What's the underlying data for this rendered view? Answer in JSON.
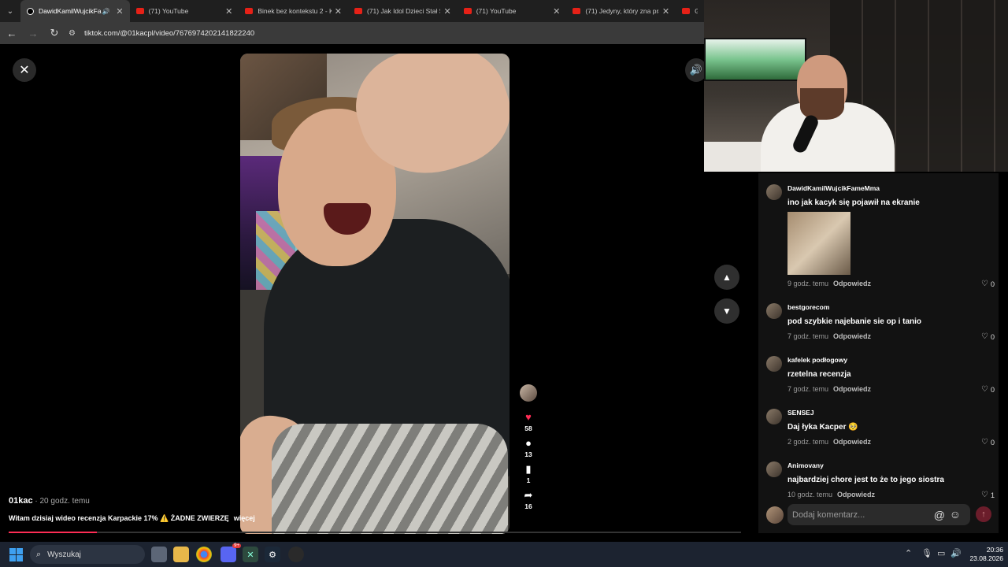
{
  "tabs": [
    {
      "title": "DawidKamilWujcikFameMma",
      "active": true,
      "icon": "tiktok-icon",
      "audio": true
    },
    {
      "title": "(71) YouTube",
      "icon": "youtube-icon"
    },
    {
      "title": "Binek bez kontekstu 2 - K",
      "icon": "youtube-icon"
    },
    {
      "title": "(71) Jak Idol Dzieci Stał Si",
      "icon": "youtube-icon"
    },
    {
      "title": "(71) YouTube",
      "icon": "youtube-icon"
    },
    {
      "title": "(71) Jedyny, który zna pra",
      "icon": "youtube-icon"
    },
    {
      "title": "Gotc",
      "icon": "youtube-icon"
    }
  ],
  "address": {
    "url": "tiktok.com/@01kacpl/video/7676974202141822240"
  },
  "video": {
    "author": "01kac",
    "time": " · 20 godz. temu",
    "description": "Witam dzisiaj wideo recenzja Karpackie 17% ⚠️ ŻADNE ZWIERZĘ",
    "more": "więcej",
    "progress": 0.12,
    "likes": "58",
    "comments": "13",
    "saves": "1",
    "shares": "16"
  },
  "comments": [
    {
      "user": "DawidKamilWujcikFameMma",
      "text": "ino jak kacyk się pojawił na ekranie",
      "time": "9 godz. temu",
      "reply": "Odpowiedz",
      "likes": "0",
      "has_image": true
    },
    {
      "user": "bestgorecom",
      "text": "pod szybkie najebanie sie op i tanio",
      "time": "7 godz. temu",
      "reply": "Odpowiedz",
      "likes": "0"
    },
    {
      "user": "kafelek podłogowy",
      "text": "rzetelna recenzja",
      "time": "7 godz. temu",
      "reply": "Odpowiedz",
      "likes": "0"
    },
    {
      "user": "SENSEJ",
      "text": "Daj łyka Kacper 🥺",
      "time": "2 godz. temu",
      "reply": "Odpowiedz",
      "likes": "0"
    },
    {
      "user": "Animovany",
      "text": "najbardziej chore jest to że to jego siostra",
      "time": "10 godz. temu",
      "reply": "Odpowiedz",
      "likes": "1"
    }
  ],
  "composer": {
    "placeholder": "Dodaj komentarz..."
  },
  "taskbar": {
    "search": "Wyszukaj",
    "time": "20:36",
    "date": "23.08.2026",
    "discord_badge": "9+"
  },
  "colors": {
    "accent": "#fe2c55",
    "panel": "#121212",
    "taskbar": "#1c2330"
  }
}
